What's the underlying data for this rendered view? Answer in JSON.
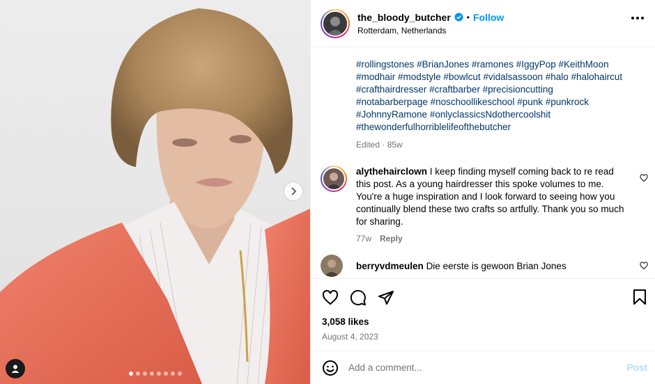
{
  "post": {
    "username": "the_bloody_butcher",
    "separator": "•",
    "follow_label": "Follow",
    "location": "Rotterdam, Netherlands"
  },
  "caption": {
    "hashtags": [
      "#rollingstones",
      "#BrianJones",
      "#ramones",
      "#IggyPop",
      "#KeithMoon",
      "#modhair",
      "#modstyle",
      "#bowlcut",
      "#vidalsassoon",
      "#halo",
      "#halohaircut",
      "#crafthairdresser",
      "#craftbarber",
      "#precisioncutting",
      "#notabarberpage",
      "#noschoollikeschool",
      "#punk",
      "#punkrock",
      "#JohnnyRamone",
      "#onlyclassicsNdothercoolshit",
      "#thewonderfulhorriblelifeofthebutcher"
    ],
    "edited": "Edited · 85w"
  },
  "comments": [
    {
      "username": "alythehairclown",
      "text": "I keep finding myself coming back to re read this post. As a young hairdresser this spoke volumes to me. You're a huge inspiration and I look forward to seeing how you continually blend these two crafts so artfully. Thank you so much for sharing.",
      "time": "77w",
      "reply_label": "Reply"
    },
    {
      "username": "berryvdmeulen",
      "text": "Die eerste is gewoon Brian Jones"
    }
  ],
  "stats": {
    "likes": "3,058 likes",
    "date": "August 4, 2023"
  },
  "add_comment": {
    "placeholder": "Add a comment...",
    "post_label": "Post"
  },
  "carousel": {
    "slide_count": 8,
    "active_index": 0
  },
  "colors": {
    "follow": "#0095f6",
    "hashtag": "#00376b",
    "muted": "#737373",
    "verified": "#0095f6",
    "jacket": "#e8715a"
  },
  "icons": [
    "verified-badge-icon",
    "more-options-icon",
    "chevron-right-icon",
    "user-tag-icon",
    "heart-icon",
    "comment-icon",
    "share-icon",
    "bookmark-icon",
    "emoji-icon"
  ]
}
